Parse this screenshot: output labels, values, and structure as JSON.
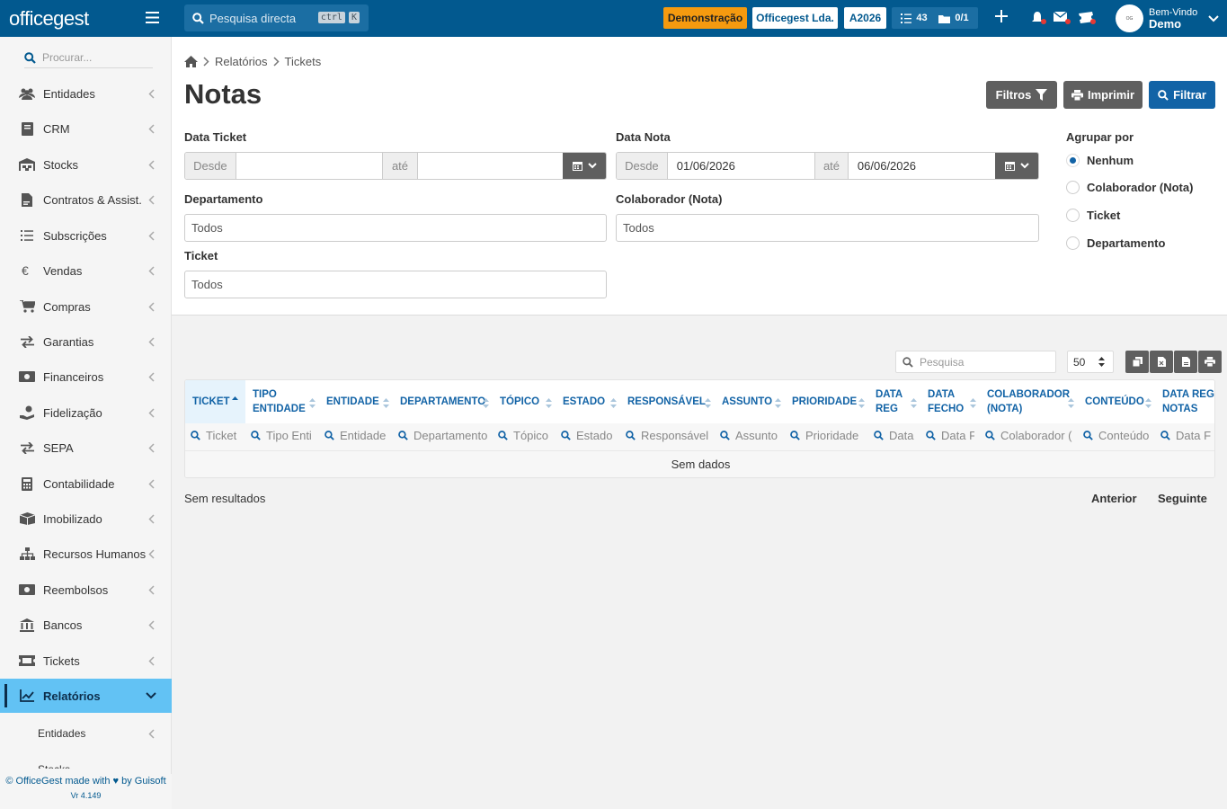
{
  "topbar": {
    "logo": "officegest",
    "search_placeholder": "Pesquisa directa",
    "kbd_ctrl": "ctrl",
    "kbd_k": "K",
    "demo_badge": "Demonstração",
    "company": "Officegest Lda.",
    "year": "A2026",
    "tasks_count": "43",
    "messages_count": "0/1",
    "welcome": "Bem-Vindo",
    "user_name": "Demo",
    "accent": "#02598f",
    "demo_color": "#f59a0f"
  },
  "sidebar": {
    "search_placeholder": "Procurar...",
    "items": [
      {
        "label": "Entidades",
        "icon": "users-icon"
      },
      {
        "label": "CRM",
        "icon": "book-icon"
      },
      {
        "label": "Stocks",
        "icon": "warehouse-icon"
      },
      {
        "label": "Contratos & Assist.",
        "icon": "contract-icon"
      },
      {
        "label": "Subscrições",
        "icon": "list-icon"
      },
      {
        "label": "Vendas",
        "icon": "euro-icon"
      },
      {
        "label": "Compras",
        "icon": "cart-icon"
      },
      {
        "label": "Garantias",
        "icon": "exchange-icon"
      },
      {
        "label": "Financeiros",
        "icon": "money-icon"
      },
      {
        "label": "Fidelização",
        "icon": "hand-coin-icon"
      },
      {
        "label": "SEPA",
        "icon": "exchange-icon"
      },
      {
        "label": "Contabilidade",
        "icon": "calculator-icon"
      },
      {
        "label": "Imobilizado",
        "icon": "box-icon"
      },
      {
        "label": "Recursos Humanos",
        "icon": "org-chart-icon"
      },
      {
        "label": "Reembolsos",
        "icon": "money-icon"
      },
      {
        "label": "Bancos",
        "icon": "bank-icon"
      },
      {
        "label": "Tickets",
        "icon": "ticket-icon"
      },
      {
        "label": "Relatórios",
        "icon": "chart-icon"
      }
    ],
    "sub_items": [
      {
        "label": "Entidades"
      },
      {
        "label": "Stocks"
      }
    ],
    "footer": "© OfficeGest made with ♥ by Guisoft",
    "version": "Vr 4.149",
    "active_color": "#62c2f4"
  },
  "breadcrumb": {
    "items": [
      "Relatórios",
      "Tickets"
    ]
  },
  "page": {
    "title": "Notas",
    "btn_filtros": "Filtros",
    "btn_imprimir": "Imprimir",
    "btn_filtrar": "Filtrar"
  },
  "filters": {
    "data_ticket": {
      "label": "Data Ticket",
      "from_addon": "Desde",
      "to_addon": "até",
      "from_value": "",
      "to_value": ""
    },
    "data_nota": {
      "label": "Data Nota",
      "from_addon": "Desde",
      "to_addon": "até",
      "from_value": "01/06/2026",
      "to_value": "06/06/2026"
    },
    "departamento": {
      "label": "Departamento",
      "value": "Todos"
    },
    "colaborador": {
      "label": "Colaborador (Nota)",
      "value": "Todos"
    },
    "ticket": {
      "label": "Ticket",
      "value": "Todos"
    },
    "agrupar": {
      "label": "Agrupar por",
      "options": [
        "Nenhum",
        "Colaborador (Nota)",
        "Ticket",
        "Departamento"
      ],
      "selected": "Nenhum"
    }
  },
  "table": {
    "search_placeholder": "Pesquisa",
    "page_size": "50",
    "columns": [
      {
        "l1": "TICKET",
        "l2": "",
        "filter": "Ticket"
      },
      {
        "l1": "TIPO",
        "l2": "ENTIDADE",
        "filter": "Tipo Enti"
      },
      {
        "l1": "ENTIDADE",
        "l2": "",
        "filter": "Entidade"
      },
      {
        "l1": "DEPARTAMENTO",
        "l2": "",
        "filter": "Departamento"
      },
      {
        "l1": "TÓPICO",
        "l2": "",
        "filter": "Tópico"
      },
      {
        "l1": "ESTADO",
        "l2": "",
        "filter": "Estado"
      },
      {
        "l1": "RESPONSÁVEL",
        "l2": "",
        "filter": "Responsável"
      },
      {
        "l1": "ASSUNTO",
        "l2": "",
        "filter": "Assunto"
      },
      {
        "l1": "PRIORIDADE",
        "l2": "",
        "filter": "Prioridade"
      },
      {
        "l1": "DATA",
        "l2": "REG",
        "filter": "Data"
      },
      {
        "l1": "DATA",
        "l2": "FECHO",
        "filter": "Data F"
      },
      {
        "l1": "COLABORADOR",
        "l2": "(NOTA)",
        "filter": "Colaborador ("
      },
      {
        "l1": "CONTEÚDO",
        "l2": "",
        "filter": "Conteúdo"
      },
      {
        "l1": "DATA REG",
        "l2": "NOTAS",
        "filter": "Data F"
      }
    ],
    "empty_text": "Sem dados",
    "results_text": "Sem resultados",
    "prev": "Anterior",
    "next": "Seguinte"
  }
}
